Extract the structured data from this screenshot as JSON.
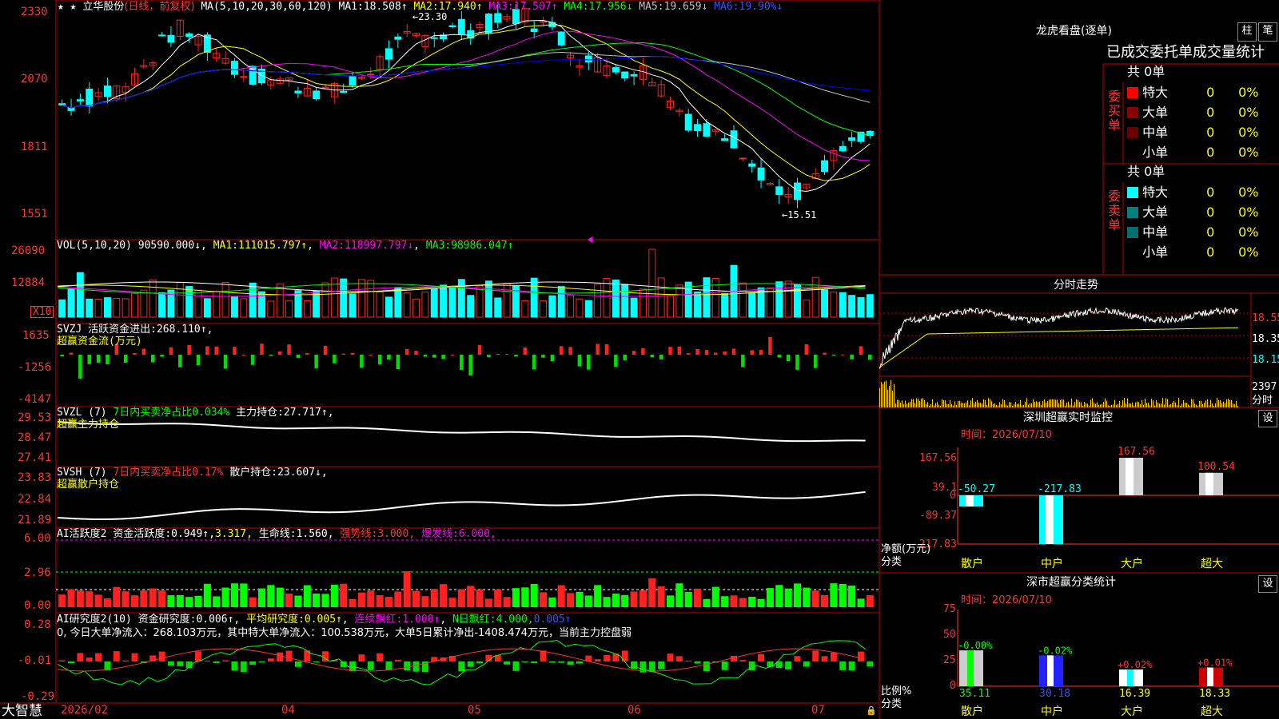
{
  "colors": {
    "up": "#ff2020",
    "down": "#00ffff",
    "ma1": "#ffffff",
    "ma2": "#ffff00",
    "ma3": "#ff00ff",
    "ma4": "#00ff00",
    "ma5": "#c0c0c0",
    "ma6": "#0000ff",
    "grid": "#b00000",
    "label": "#ff3333"
  },
  "main": {
    "header": {
      "star": "★ ★",
      "stock": "立华股份",
      "period": "(日线，前复权)",
      "ma_title": "MA(5,10,20,30,60,120)",
      "ma": [
        {
          "n": "MA1:",
          "v": "18.508↑"
        },
        {
          "n": "MA2:",
          "v": "17.940↑"
        },
        {
          "n": "MA3:",
          "v": "17.507↑"
        },
        {
          "n": "MA4:",
          "v": "17.956↓"
        },
        {
          "n": "MA5:",
          "v": "19.659↓"
        },
        {
          "n": "MA6:",
          "v": "19.90%↓"
        }
      ]
    },
    "yticks": [
      "2330",
      "2070",
      "1811",
      "1551"
    ],
    "high_label": "←23.30",
    "low_label": "←15.51",
    "ylim": [
      15.0,
      23.5
    ]
  },
  "vol": {
    "title": "VOL(5,10,20)",
    "v": "90590.000↓",
    "ma": [
      {
        "n": "MA1:",
        "v": "111015.797↑"
      },
      {
        "n": "MA2:",
        "v": "118997.797↓"
      },
      {
        "n": "MA3:",
        "v": "98986.047↑"
      }
    ],
    "yticks": [
      "26090",
      "12884"
    ],
    "unit": "X10"
  },
  "svzj": {
    "title": "SVZJ  活跃资金进出:",
    "v": "268.110↑,",
    "sub": "超赢资金流(万元)",
    "yticks": [
      "1635",
      "-1256",
      "-4147"
    ]
  },
  "svzl": {
    "title": "SVZL (7)",
    "ratio": "7日内买卖净占比0.034%",
    "hold": "主力持仓:",
    "hv": "27.717↑,",
    "sub": "超赢主力持仓",
    "yticks": [
      "29.53",
      "28.47",
      "27.41"
    ]
  },
  "svsh": {
    "title": "SVSH (7)",
    "ratio": "7日内买卖净占比0.17%",
    "hold": "散户持仓:",
    "hv": "23.607↓,",
    "sub": "超赢散户持仓",
    "yticks": [
      "23.83",
      "22.84",
      "21.89"
    ]
  },
  "ai1": {
    "title": "AI活跃度2",
    "a": "资金活跃度:",
    "av": "0.949↑",
    "b": "3.317,",
    "c": "生命线:",
    "cv": "1.560,",
    "d": "强势线:",
    "dv": "3.000,",
    "e": "爆发线:",
    "ev": "6.000,",
    "yticks": [
      "6.00",
      "2.96",
      "0.00"
    ]
  },
  "ai2": {
    "title": "AI研究度2(10)",
    "a": "资金研究度:",
    "av": "0.006↑",
    "b": "平均研究度:",
    "bv": "0.005↑",
    "c": "连续飘红:",
    "cv": "1.000↑",
    "d": "N日飘红:",
    "dv": "4.000,",
    "e": "0.005↑",
    "note": "0, 今日大单净流入：268.103万元，其中特大单净流入：100.538万元，大单5日累计净出-1408.474万元，当前主力控盘弱",
    "yticks": [
      "0.28",
      "-0.01",
      "-0.29"
    ]
  },
  "xaxis": {
    "brand": "大智慧",
    "labels": [
      "2026/02",
      "04",
      "05",
      "06",
      "07"
    ]
  },
  "dragon": {
    "title": "龙虎看盘(逐单)",
    "tab1": "柱",
    "tab2": "笔",
    "header": "已成交委托单成交量统计",
    "buy": {
      "total": "共 0单",
      "side": "委买单",
      "rows": [
        {
          "name": "特大",
          "v": "0",
          "p": "0%",
          "c": "#ff0000"
        },
        {
          "name": "大单",
          "v": "0",
          "p": "0%",
          "c": "#8b0000"
        },
        {
          "name": "中单",
          "v": "0",
          "p": "0%",
          "c": "#6b0000"
        },
        {
          "name": "小单",
          "v": "0",
          "p": "0%",
          "c": "#000000"
        }
      ]
    },
    "sell": {
      "total": "共 0单",
      "side": "委卖单",
      "rows": [
        {
          "name": "特大",
          "v": "0",
          "p": "0%",
          "c": "#00ffff"
        },
        {
          "name": "大单",
          "v": "0",
          "p": "0%",
          "c": "#008080"
        },
        {
          "name": "中单",
          "v": "0",
          "p": "0%",
          "c": "#007070"
        },
        {
          "name": "小单",
          "v": "0",
          "p": "0%",
          "c": "#000000"
        }
      ]
    }
  },
  "intraday": {
    "title": "分时走势",
    "yticks": [
      "18.55",
      "18.35",
      "18.15"
    ],
    "vol": "2397",
    "unit": "分时"
  },
  "sz_monitor": {
    "title": "深圳超赢实时监控",
    "set": "设",
    "time": "时间：2026/07/10",
    "yticks": [
      "167.56",
      "39.1",
      "0",
      "-89.37",
      "-217.83"
    ],
    "ylabel": "净额(万元)",
    "xlabel": "分类",
    "chart_data": {
      "type": "bar",
      "categories": [
        "散户",
        "中户",
        "大户",
        "超大"
      ],
      "values": [
        -50.27,
        -217.83,
        167.56,
        100.54
      ],
      "labels": [
        "-50.27",
        "-217.83",
        "167.56",
        "100.54"
      ],
      "ylim": [
        -217.83,
        167.56
      ]
    }
  },
  "sz_class": {
    "title": "深市超赢分类统计",
    "set": "设",
    "time": "时间：2026/07/10",
    "yticks": [
      "75",
      "50",
      "25",
      "0"
    ],
    "ylabel": "比例%",
    "xlabel": "分类",
    "chart_data": {
      "type": "bar",
      "categories": [
        "散户",
        "中户",
        "大户",
        "超大"
      ],
      "values": [
        35.11,
        30.18,
        16.39,
        18.33
      ],
      "changes": [
        "-0.00%",
        "-0.02%",
        "+0.02%",
        "+0.01%"
      ],
      "ylim": [
        0,
        75
      ]
    }
  }
}
